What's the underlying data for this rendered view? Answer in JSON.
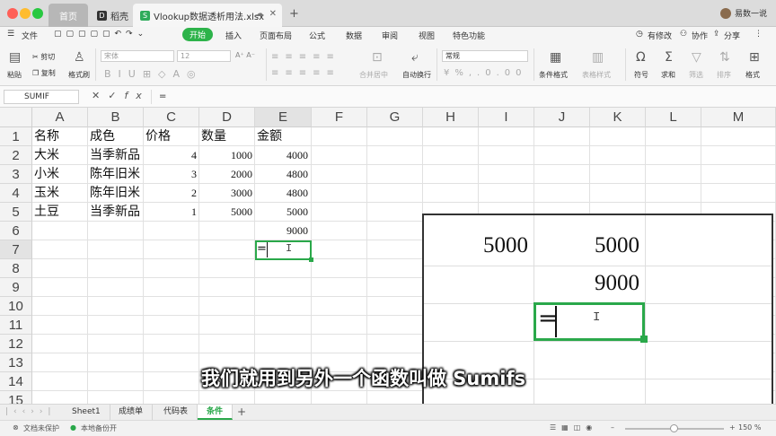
{
  "titlebar": {
    "tabs": [
      {
        "label": "首页"
      },
      {
        "label": "稻壳"
      },
      {
        "label": "Vlookup数据透析用法.xlsx"
      }
    ],
    "user_name": "易数一说"
  },
  "menubar": {
    "file_label": "文件",
    "items": [
      "开始",
      "插入",
      "页面布局",
      "公式",
      "数据",
      "审阅",
      "视图",
      "特色功能"
    ],
    "right_items": [
      "有修改",
      "协作",
      "分享"
    ]
  },
  "ribbon": {
    "paste": "粘贴",
    "cut": "剪切",
    "copy": "复制",
    "format_painter": "格式刷",
    "font_name": "宋体",
    "font_size": "12",
    "merge_center": "合并居中",
    "wrap": "自动换行",
    "number_format": "常规",
    "conditional_format": "条件格式",
    "table_style": "表格样式",
    "symbol": "符号",
    "sum": "求和",
    "filter": "筛选",
    "sort": "排序",
    "format": "格式"
  },
  "formula_bar": {
    "name_box": "SUMIF",
    "cancel_icon": "✕",
    "confirm_icon": "✓",
    "fx_label": "fx",
    "formula": "="
  },
  "grid": {
    "columns": [
      "A",
      "B",
      "C",
      "D",
      "E",
      "F",
      "G",
      "H",
      "I",
      "J",
      "K",
      "L",
      "M"
    ],
    "rows": [
      "1",
      "2",
      "3",
      "4",
      "5",
      "6",
      "7",
      "8",
      "9",
      "10",
      "11",
      "12",
      "13",
      "14",
      "15"
    ],
    "highlight_column": "E",
    "highlight_row": "7",
    "cells": {
      "A1": "名称",
      "B1": "成色",
      "C1": "价格",
      "D1": "数量",
      "E1": "金额",
      "A2": "大米",
      "B2": "当季新品",
      "C2": "4",
      "D2": "1000",
      "E2": "4000",
      "A3": "小米",
      "B3": "陈年旧米",
      "C3": "3",
      "D3": "2000",
      "E3": "4800",
      "A4": "玉米",
      "B4": "陈年旧米",
      "C4": "2",
      "D4": "3000",
      "E4": "4800",
      "A5": "土豆",
      "B5": "当季新品",
      "C5": "1",
      "D5": "5000",
      "E5": "5000",
      "E6": "9000",
      "E7": "="
    }
  },
  "zoom_overlay": {
    "values": [
      "5000",
      "5000",
      "9000"
    ],
    "active_text": "="
  },
  "subtitle": "我们就用到另外一个函数叫做 Sumifs",
  "sheets": {
    "tabs": [
      "Sheet1",
      "成绩单",
      "代码表",
      "条件"
    ],
    "active": "条件"
  },
  "statusbar": {
    "protect": "文档未保护",
    "backup": "本地备份开",
    "zoom": "150 %"
  }
}
